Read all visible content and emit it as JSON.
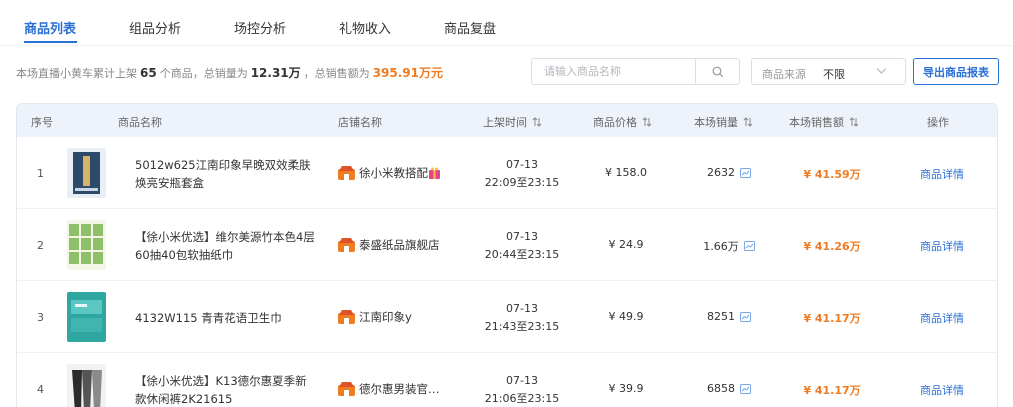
{
  "tabs": [
    {
      "label": "商品列表",
      "active": true
    },
    {
      "label": "组品分析",
      "active": false
    },
    {
      "label": "场控分析",
      "active": false
    },
    {
      "label": "礼物收入",
      "active": false
    },
    {
      "label": "商品复盘",
      "active": false
    }
  ],
  "summary": {
    "prefix": "本场直播小黄车累计上架",
    "product_count": "65",
    "mid1": "个商品，总销量为",
    "total_sales": "12.31万",
    "mid2": "，总销售额为",
    "total_amount": "395.91万元"
  },
  "search": {
    "placeholder": "请输入商品名称",
    "value": ""
  },
  "source_filter": {
    "label": "商品来源",
    "value": "不限"
  },
  "export_label": "导出商品报表",
  "columns": [
    "序号",
    "商品名称",
    "店铺名称",
    "上架时间",
    "商品价格",
    "本场销量",
    "本场销售额",
    "操作"
  ],
  "rows": [
    {
      "index": "1",
      "name_line1": "5012w625江南印象早晚双效柔肤",
      "name_line2": "焕亮安瓶套盒",
      "shop": "徐小米教搭配",
      "shelf_date": "07-13",
      "shelf_time": "22:09至23:15",
      "price": "¥ 158.0",
      "sales": "2632",
      "amount": "¥ 41.59万",
      "action": "商品详情"
    },
    {
      "index": "2",
      "name_line1": "【徐小米优选】维尔美源竹本色4层",
      "name_line2": "60抽40包软抽纸巾",
      "shop": "泰盛纸品旗舰店",
      "shelf_date": "07-13",
      "shelf_time": "20:44至23:15",
      "price": "¥ 24.9",
      "sales": "1.66万",
      "amount": "¥ 41.26万",
      "action": "商品详情"
    },
    {
      "index": "3",
      "name_line1": "4132W115 青青花语卫生巾",
      "name_line2": "",
      "shop": "江南印象y",
      "shelf_date": "07-13",
      "shelf_time": "21:43至23:15",
      "price": "¥ 49.9",
      "sales": "8251",
      "amount": "¥ 41.17万",
      "action": "商品详情"
    },
    {
      "index": "4",
      "name_line1": "【徐小米优选】K13德尔惠夏季新",
      "name_line2": "款休闲裤2K21615",
      "shop": "德尔惠男装官…",
      "shelf_date": "07-13",
      "shelf_time": "21:06至23:15",
      "price": "¥ 39.9",
      "sales": "6858",
      "amount": "¥ 41.17万",
      "action": "商品详情"
    }
  ],
  "colors": {
    "accent": "#2a6fd6",
    "orange": "#f07b21",
    "header_bg": "#eef3fb"
  }
}
